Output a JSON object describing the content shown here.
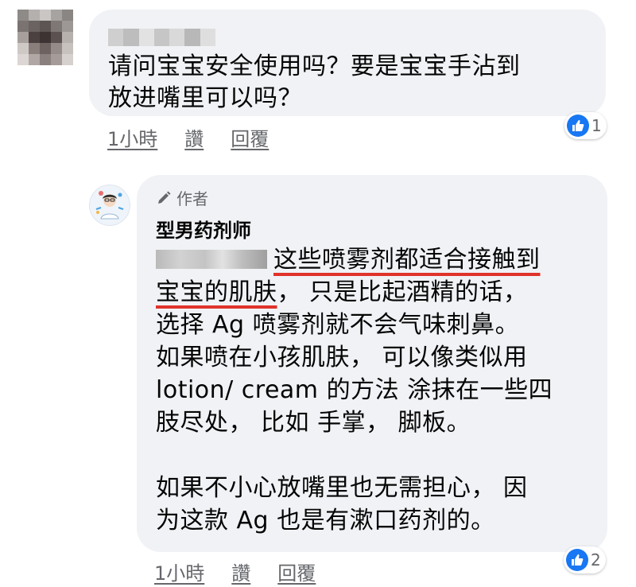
{
  "comment_1": {
    "author_name": "",
    "text_line_1": "请问宝宝安全使用吗？要是宝宝手沾到",
    "text_line_2": "放进嘴里可以吗？",
    "time": "1小時",
    "like_label": "讚",
    "reply_label": "回覆",
    "reaction_count": "1",
    "colors": {
      "bubble": "#f0f2f5",
      "action_text": "#65676b"
    },
    "icons": {
      "reaction": "thumbs-up-icon"
    }
  },
  "reply": {
    "author_badge": "作者",
    "author_name": "型男药剂师",
    "mention": "",
    "line_1": "这些喷雾剂都适合接触到",
    "line_2_underlined": "宝宝的肌肤",
    "line_2_rest": "， 只是比起酒精的话，",
    "line_3": "选择 Ag 喷雾剂就不会气味刺鼻。",
    "line_4": "如果喷在小孩肌肤， 可以像类似用",
    "line_5": "lotion/ cream 的方法 涂抹在一些四",
    "line_6": "肢尽处， 比如 手掌， 脚板。",
    "line_7": "如果不小心放嘴里也无需担心， 因",
    "line_8": "为这款 Ag 也是有漱口药剂的。",
    "time": "1小時",
    "like_label": "讚",
    "reply_label": "回覆",
    "reaction_count": "2",
    "colors": {
      "highlight_underline": "#e0322b",
      "like_blue": "#1877f2"
    },
    "icons": {
      "badge": "pencil-icon",
      "reaction": "thumbs-up-icon"
    }
  }
}
